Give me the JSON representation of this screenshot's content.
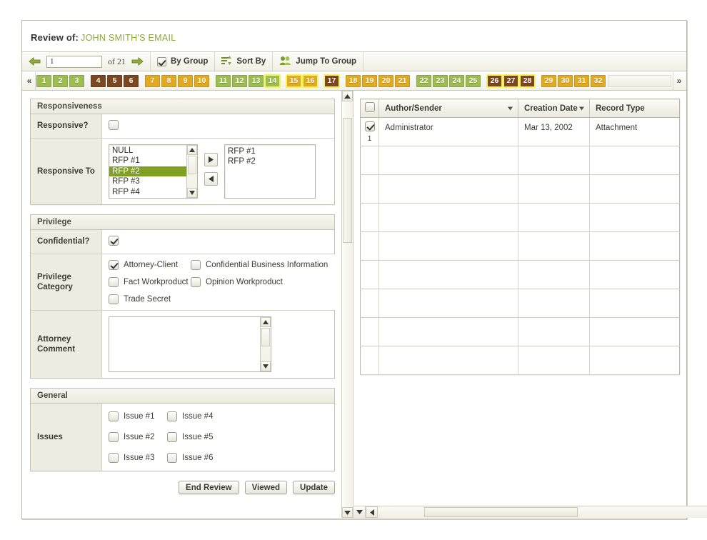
{
  "header": {
    "static_label": "Review of:",
    "document_title": "JOHN SMITH'S EMAIL"
  },
  "toolbar": {
    "prev_icon": "arrow-left-icon",
    "page_value": "1",
    "page_placeholder": "",
    "of_label": "of 21",
    "next_icon": "arrow-right-icon",
    "by_group_label": "By Group",
    "by_group_checked": true,
    "sort_by_label": "Sort By",
    "jump_to_group_label": "Jump To Group"
  },
  "pagination": {
    "first_label": "«",
    "last_label": "»",
    "groups": [
      {
        "color": "green",
        "pages": [
          "1",
          "2",
          "3"
        ]
      },
      {
        "color": "brown",
        "pages": [
          "4",
          "5",
          "6"
        ]
      },
      {
        "color": "gold",
        "pages": [
          "7",
          "8",
          "9",
          "10"
        ]
      },
      {
        "color": "green",
        "pages": [
          "11",
          "12",
          "13",
          "14"
        ]
      },
      {
        "color": "gold",
        "pages": [
          "15",
          "16"
        ]
      },
      {
        "color": "brown",
        "pages": [
          "17"
        ]
      },
      {
        "color": "gold",
        "pages": [
          "18",
          "19",
          "20",
          "21"
        ]
      },
      {
        "color": "green",
        "pages": [
          "22",
          "23",
          "24",
          "25"
        ]
      },
      {
        "color": "brown",
        "pages": [
          "26",
          "27",
          "28"
        ]
      },
      {
        "color": "gold",
        "pages": [
          "29",
          "30",
          "31",
          "32"
        ]
      }
    ],
    "highlighted_pages": [
      "14",
      "15",
      "16",
      "17",
      "26",
      "27",
      "28"
    ]
  },
  "form": {
    "responsiveness": {
      "section_title": "Responsiveness",
      "responsive_label": "Responsive?",
      "responsive_checked": false,
      "responsive_to_label": "Responsive To",
      "source_options": [
        "NULL",
        "RFP #1",
        "RFP #2",
        "RFP #3",
        "RFP #4"
      ],
      "selected_source": "RFP #2",
      "selected_values": [
        "RFP #1",
        "RFP #2"
      ],
      "add_icon": "arrow-right-icon",
      "remove_icon": "arrow-left-icon"
    },
    "privilege": {
      "section_title": "Privilege",
      "confidential_label": "Confidential?",
      "confidential_checked": true,
      "category_label": "Privilege Category",
      "categories": [
        {
          "label": "Attorney-Client",
          "checked": true
        },
        {
          "label": "Confidential Business Information",
          "checked": false
        },
        {
          "label": "Fact Workproduct",
          "checked": false
        },
        {
          "label": "Opinion Workproduct",
          "checked": false
        },
        {
          "label": "Trade Secret",
          "checked": false
        }
      ],
      "attorney_comment_label": "Attorney Comment",
      "attorney_comment_value": "",
      "attorney_comment_placeholder": ""
    },
    "general": {
      "section_title": "General",
      "issues_label": "Issues",
      "issues": [
        {
          "label": "Issue #1",
          "checked": false
        },
        {
          "label": "Issue #2",
          "checked": false
        },
        {
          "label": "Issue #3",
          "checked": false
        },
        {
          "label": "Issue #4",
          "checked": false
        },
        {
          "label": "Issue #5",
          "checked": false
        },
        {
          "label": "Issue #6",
          "checked": false
        }
      ]
    }
  },
  "actions": {
    "end_review_label": "End Review",
    "viewed_label": "Viewed",
    "update_label": "Update"
  },
  "records_table": {
    "select_all_checked": false,
    "columns": [
      {
        "label": "Author/Sender",
        "sortable": true
      },
      {
        "label": "Creation Date",
        "sortable": true
      },
      {
        "label": "Record Type",
        "sortable": false
      }
    ],
    "rows": [
      {
        "row_number": "1",
        "checked": true,
        "author_sender": "Administrator",
        "creation_date": "Mar 13, 2002",
        "record_type": "Attachment"
      }
    ],
    "empty_row_count": 8
  },
  "colors": {
    "accent_green": "#8aa83c",
    "page_green": "#9dbc52",
    "page_gold": "#e0ab23",
    "page_brown": "#7c4620",
    "page_highlight": "#f3f360",
    "list_selection": "#80a023",
    "panel_label_bg": "#ecece1"
  }
}
